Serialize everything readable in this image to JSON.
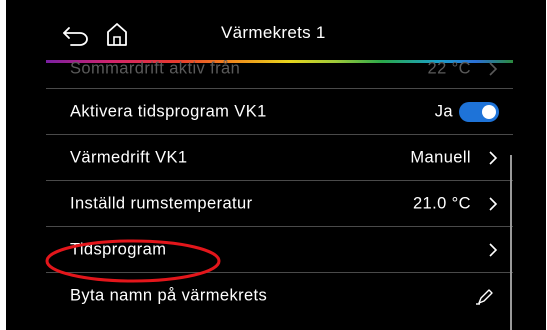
{
  "header": {
    "title": "Värmekrets 1",
    "back_icon": "back-arrow-icon",
    "home_icon": "home-icon"
  },
  "rows": [
    {
      "label": "Sommardrift aktiv från",
      "value": "22 °C",
      "trailing": "chevron-right-icon",
      "faded": true
    },
    {
      "label": "Aktivera tidsprogram VK1",
      "value": "Ja",
      "trailing": "toggle",
      "toggle_on": true
    },
    {
      "label": "Värmedrift VK1",
      "value": "Manuell",
      "trailing": "chevron-right-icon"
    },
    {
      "label": "Inställd rumstemperatur",
      "value": "21.0 °C",
      "trailing": "chevron-right-icon"
    },
    {
      "label": "Tidsprogram",
      "value": "",
      "trailing": "chevron-right-icon"
    },
    {
      "label": "Byta namn på värmekrets",
      "value": "",
      "trailing": "pencil-icon"
    }
  ],
  "colors": {
    "background": "#000000",
    "text": "#ffffff",
    "toggle_on": "#1e73d8",
    "annotation": "#e3161b"
  }
}
